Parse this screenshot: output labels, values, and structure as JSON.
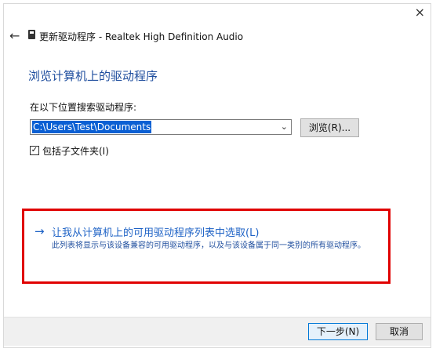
{
  "window": {
    "title": "更新驱动程序 - Realtek High Definition Audio",
    "close_glyph": "×",
    "back_glyph": "←"
  },
  "main": {
    "heading": "浏览计算机上的驱动程序",
    "search_label": "在以下位置搜索驱动程序:",
    "path_value": "C:\\Users\\Test\\Documents",
    "combo_arrow_glyph": "⌄",
    "browse_button": "浏览(R)...",
    "include_subfolders_label": "包括子文件夹(I)",
    "include_subfolders_checked": true,
    "check_glyph": "✓"
  },
  "pick_option": {
    "arrow_glyph": "→",
    "title": "让我从计算机上的可用驱动程序列表中选取(L)",
    "description": "此列表将显示与该设备兼容的可用驱动程序，以及与该设备属于同一类别的所有驱动程序。"
  },
  "footer": {
    "next_button": "下一步(N)",
    "cancel_button": "取消"
  },
  "colors": {
    "heading": "#1f4e9e",
    "link": "#1f63c6",
    "highlight_box": "#e00000",
    "selection": "#0a5fd3"
  },
  "icons": {
    "device": "device-icon",
    "back": "back-arrow-icon",
    "close": "close-icon"
  }
}
